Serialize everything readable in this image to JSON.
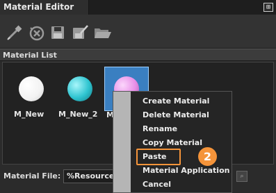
{
  "window": {
    "title": "Material Editor",
    "pin_glyph": "⊞"
  },
  "toolbar": {
    "buttons": [
      {
        "name": "eyedropper-icon"
      },
      {
        "name": "reset-icon"
      },
      {
        "name": "save-icon"
      },
      {
        "name": "save-as-icon"
      },
      {
        "name": "open-folder-icon"
      }
    ]
  },
  "material_list": {
    "header": "Material List",
    "items": [
      {
        "label": "M_New",
        "color": "#ffffff"
      },
      {
        "label": "M_New_2",
        "color": "#2ec4d0"
      },
      {
        "label": "M",
        "color": "#e88fe8",
        "selected": true
      }
    ]
  },
  "context_menu": {
    "items": [
      {
        "label": "Create Material"
      },
      {
        "label": "Delete Material"
      },
      {
        "label": "Rename"
      },
      {
        "label": "Copy Material"
      },
      {
        "label": "Paste",
        "highlighted": true
      },
      {
        "label": "Material Application"
      },
      {
        "label": "Cancel"
      }
    ]
  },
  "step_badge": "2",
  "material_file": {
    "label": "Material File:",
    "value": "%Resource\\"
  },
  "colors": {
    "accent": "#f5943a",
    "selection": "#3a7fc1"
  }
}
